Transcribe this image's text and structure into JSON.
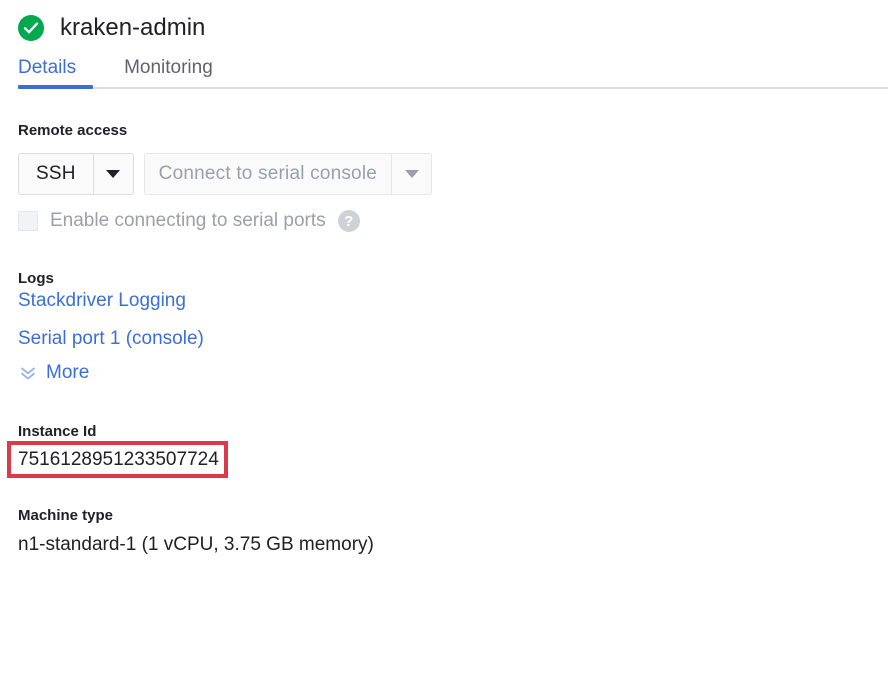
{
  "header": {
    "status_icon": "green-check-circle-icon",
    "status_color": "#00a94f",
    "title": "kraken-admin"
  },
  "tabs": {
    "active_index": 0,
    "accent_color": "#3b6fd4",
    "items": [
      {
        "label": "Details"
      },
      {
        "label": "Monitoring"
      }
    ]
  },
  "remote_access": {
    "section_title": "Remote access",
    "ssh_button": {
      "label": "SSH",
      "caret_icon": "caret-down-icon",
      "disabled": false
    },
    "serial_console_button": {
      "label": "Connect to serial console",
      "caret_icon": "caret-down-icon",
      "disabled": true
    },
    "serial_ports_checkbox": {
      "label": "Enable connecting to serial ports",
      "checked": false,
      "disabled": true,
      "help_icon": "help-circle-icon",
      "help_glyph": "?"
    }
  },
  "logs": {
    "section_title": "Logs",
    "links": [
      {
        "label": "Stackdriver Logging"
      },
      {
        "label": "Serial port 1 (console)"
      }
    ],
    "more": {
      "label": "More",
      "icon": "double-chevron-down-icon"
    }
  },
  "instance_id": {
    "section_title": "Instance Id",
    "value": "7516128951233507724",
    "highlight_color": "#d93b4a"
  },
  "machine_type": {
    "section_title": "Machine type",
    "value": "n1-standard-1 (1 vCPU, 3.75 GB memory)"
  }
}
